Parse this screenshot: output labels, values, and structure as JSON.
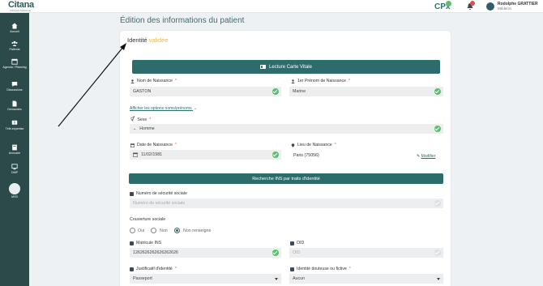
{
  "topbar": {
    "logo": "Citana",
    "logo_sub": "FRANCE MEDICAL",
    "cpx": "CPx",
    "user_name": "Rodolphe GRATTIER",
    "user_role": "Médecin"
  },
  "sidebar": {
    "items": [
      {
        "label": "Accueil",
        "icon": "home-icon"
      },
      {
        "label": "Patients",
        "icon": "users-icon"
      },
      {
        "label": "Agenda / Planning",
        "icon": "calendar-icon"
      },
      {
        "label": "Discussions",
        "icon": "chat-icon"
      },
      {
        "label": "Demandes",
        "icon": "document-icon"
      },
      {
        "label": "Télé-expertise",
        "icon": "alert-icon"
      },
      {
        "label": "Annuaire",
        "icon": "book-icon"
      },
      {
        "label": "DMP",
        "icon": "dmp-icon"
      },
      {
        "label": "MSS",
        "icon": "mss-icon"
      }
    ]
  },
  "page": {
    "title": "Édition des informations du patient",
    "card_title": "Identité",
    "card_status": "validée"
  },
  "form": {
    "carte_vitale_button": "Lecture Carte Vitale",
    "nom_naissance": {
      "label": "Nom de Naissance",
      "value": "GASTON"
    },
    "prenom": {
      "label": "1er Prénom de Naissance",
      "value": "Marine"
    },
    "options_link": "Afficher les options noms/prénoms",
    "sexe": {
      "label": "Sexe",
      "value": "Homme"
    },
    "date_naissance": {
      "label": "Date de Naissance",
      "value": "11/02/1981"
    },
    "lieu_naissance": {
      "label": "Lieu de Naissance",
      "value": "Paris (75056)",
      "action": "Modifier"
    },
    "ins_button": "Recherche INS par traits d'identité",
    "secu": {
      "label": "Numéro de sécurité sociale",
      "placeholder": "Numéro de sécurité sociale"
    },
    "couverture": {
      "label": "Couverture sociale",
      "options": [
        "Oui",
        "Non",
        "Non renseigne"
      ],
      "selected": "Non renseigne"
    },
    "matricule": {
      "label": "Matricule INS",
      "value": "1262626262626262626"
    },
    "oid": {
      "label": "OID",
      "placeholder": "OID"
    },
    "justificatif": {
      "label": "Justificatif d'identité",
      "value": "Passeport"
    },
    "identite_douteuse": {
      "label": "Identité douteuse ou fictive",
      "value": "Aucun"
    }
  },
  "colors": {
    "sidebar": "#2c4a4a",
    "accent": "#2c6d6b",
    "valid": "#e8b84a",
    "check": "#5bbf6a"
  }
}
